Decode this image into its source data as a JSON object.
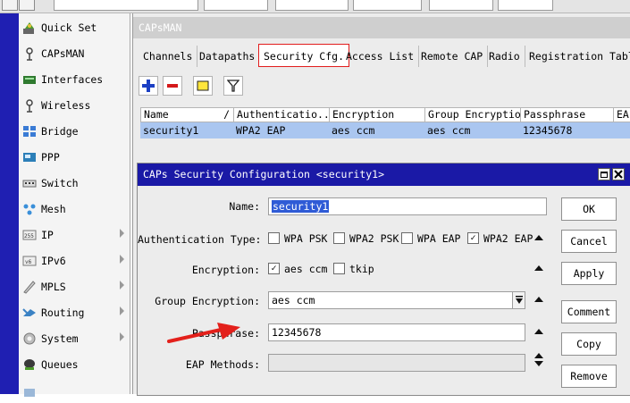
{
  "sidebar": {
    "items": [
      {
        "label": "Quick Set",
        "icon": "quick-set-icon",
        "submenu": false
      },
      {
        "label": "CAPsMAN",
        "icon": "capsman-icon",
        "submenu": false
      },
      {
        "label": "Interfaces",
        "icon": "interfaces-icon",
        "submenu": false
      },
      {
        "label": "Wireless",
        "icon": "wireless-icon",
        "submenu": false
      },
      {
        "label": "Bridge",
        "icon": "bridge-icon",
        "submenu": false
      },
      {
        "label": "PPP",
        "icon": "ppp-icon",
        "submenu": false
      },
      {
        "label": "Switch",
        "icon": "switch-icon",
        "submenu": false
      },
      {
        "label": "Mesh",
        "icon": "mesh-icon",
        "submenu": false
      },
      {
        "label": "IP",
        "icon": "ip-icon",
        "submenu": true
      },
      {
        "label": "IPv6",
        "icon": "ipv6-icon",
        "submenu": true
      },
      {
        "label": "MPLS",
        "icon": "mpls-icon",
        "submenu": true
      },
      {
        "label": "Routing",
        "icon": "routing-icon",
        "submenu": true
      },
      {
        "label": "System",
        "icon": "system-icon",
        "submenu": true
      },
      {
        "label": "Queues",
        "icon": "queues-icon",
        "submenu": false
      }
    ]
  },
  "window": {
    "title": "CAPsMAN",
    "tabs": [
      "Channels",
      "Datapaths",
      "Security Cfg.",
      "Access List",
      "Remote CAP",
      "Radio",
      "Registration Table"
    ],
    "active_tab": "Security Cfg.",
    "toolbar": [
      "add-icon",
      "remove-icon",
      "comment-icon",
      "filter-icon"
    ],
    "table": {
      "columns": [
        "Name",
        "Authenticatio...",
        "Encryption",
        "Group Encryption",
        "Passphrase",
        "EA"
      ],
      "sort_marker": "/",
      "rows": [
        [
          "security1",
          "WPA2 EAP",
          "aes ccm",
          "aes ccm",
          "12345678",
          ""
        ]
      ]
    }
  },
  "dialog": {
    "title": "CAPs Security Configuration <security1>",
    "fields": {
      "name": {
        "label": "Name:",
        "value": "security1"
      },
      "auth": {
        "label": "Authentication Type:",
        "options": [
          {
            "label": "WPA PSK",
            "checked": false
          },
          {
            "label": "WPA2 PSK",
            "checked": false
          },
          {
            "label": "WPA EAP",
            "checked": false
          },
          {
            "label": "WPA2 EAP",
            "checked": true
          }
        ]
      },
      "encryption": {
        "label": "Encryption:",
        "options": [
          {
            "label": "aes ccm",
            "checked": true
          },
          {
            "label": "tkip",
            "checked": false
          }
        ]
      },
      "group_encryption": {
        "label": "Group Encryption:",
        "value": "aes ccm"
      },
      "passphrase": {
        "label": "Passphrase:",
        "value": "12345678"
      },
      "eap_methods": {
        "label": "EAP Methods:",
        "value": ""
      }
    },
    "buttons": [
      "OK",
      "Cancel",
      "Apply",
      "Comment",
      "Copy",
      "Remove"
    ],
    "check_glyph": "✓"
  },
  "colors": {
    "menu_stripe": "#1f1fb2",
    "dialog_title": "#1a19a6",
    "selected_row": "#aac6f0",
    "active_tab_border": "#e21d1d",
    "annotation_arrow": "#e3201b"
  }
}
